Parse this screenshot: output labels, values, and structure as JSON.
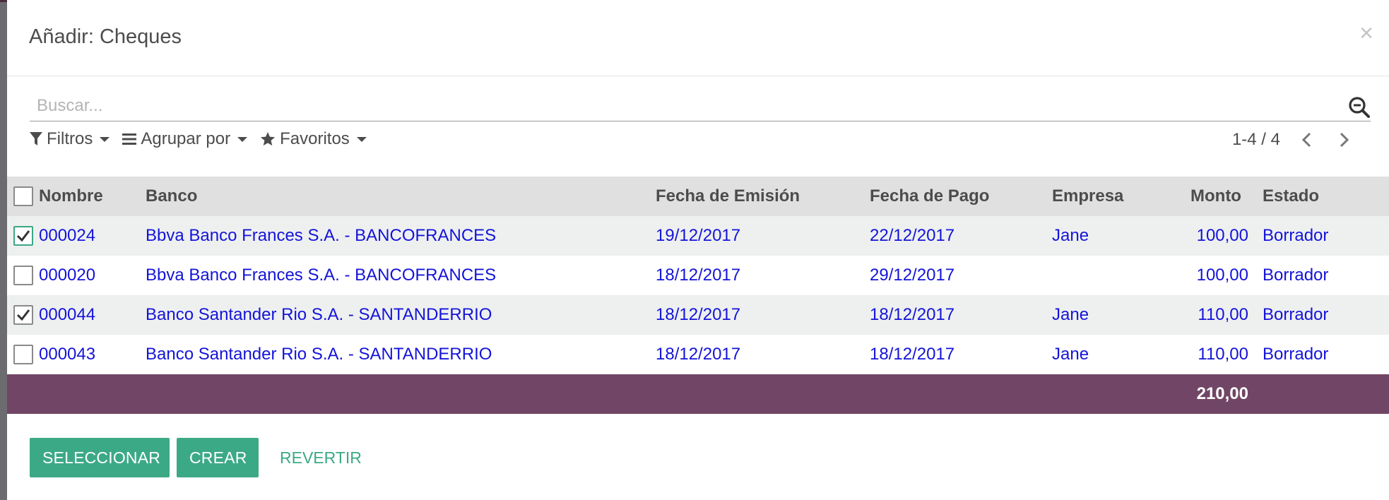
{
  "modal": {
    "title": "Añadir: Cheques",
    "close_symbol": "×"
  },
  "search": {
    "placeholder": "Buscar..."
  },
  "filters": {
    "filtros": "Filtros",
    "agrupar": "Agrupar por",
    "favoritos": "Favoritos"
  },
  "pager": {
    "range": "1-4 / 4"
  },
  "table": {
    "columns": {
      "nombre": "Nombre",
      "banco": "Banco",
      "fecha_emision": "Fecha de Emisión",
      "fecha_pago": "Fecha de Pago",
      "empresa": "Empresa",
      "monto": "Monto",
      "estado": "Estado"
    },
    "rows": [
      {
        "checked": true,
        "nombre": "000024",
        "banco": "Bbva Banco Frances S.A. - BANCOFRANCES",
        "fecha_emision": "19/12/2017",
        "fecha_pago": "22/12/2017",
        "empresa": "Jane",
        "monto": "100,00",
        "estado": "Borrador"
      },
      {
        "checked": false,
        "nombre": "000020",
        "banco": "Bbva Banco Frances S.A. - BANCOFRANCES",
        "fecha_emision": "18/12/2017",
        "fecha_pago": "29/12/2017",
        "empresa": "",
        "monto": "100,00",
        "estado": "Borrador"
      },
      {
        "checked": true,
        "nombre": "000044",
        "banco": "Banco Santander Rio S.A. - SANTANDERRIO",
        "fecha_emision": "18/12/2017",
        "fecha_pago": "18/12/2017",
        "empresa": "Jane",
        "monto": "110,00",
        "estado": "Borrador"
      },
      {
        "checked": false,
        "nombre": "000043",
        "banco": "Banco Santander Rio S.A. - SANTANDERRIO",
        "fecha_emision": "18/12/2017",
        "fecha_pago": "18/12/2017",
        "empresa": "Jane",
        "monto": "110,00",
        "estado": "Borrador"
      }
    ],
    "total": "210,00"
  },
  "footer": {
    "seleccionar": "SELECCIONAR",
    "crear": "CREAR",
    "revertir": "REVERTIR"
  },
  "colors": {
    "primary": "#3ca986",
    "total_bar": "#714565",
    "link": "#1414d9"
  },
  "icons": {
    "close": "close-icon",
    "search": "search-icon",
    "filter": "filter-icon",
    "group": "list-icon",
    "favorites": "star-icon",
    "prev": "chevron-left-icon",
    "next": "chevron-right-icon",
    "check": "check-icon"
  }
}
